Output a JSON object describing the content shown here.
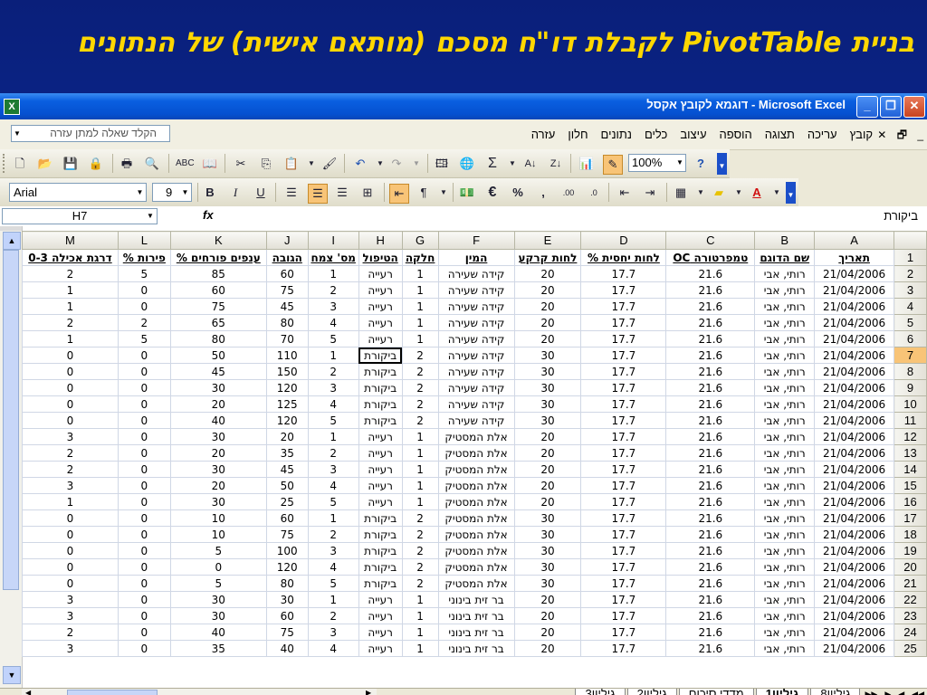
{
  "slide": {
    "title_pre": "בניית",
    "title_pivot": "PivotTable",
    "title_post": "לקבלת דו\"ח מסכם (מותאם אישית) של הנתונים"
  },
  "window": {
    "title": "Microsoft Excel - דוגמא לקובץ אקסל",
    "min": "_",
    "restore": "❐",
    "close": "✕"
  },
  "menubar": {
    "items": [
      "קובץ",
      "עריכה",
      "תצוגה",
      "הוספה",
      "עיצוב",
      "כלים",
      "נתונים",
      "חלון",
      "עזרה"
    ],
    "help_placeholder": "הקלד שאלה למתן עזרה",
    "doc_icons": [
      "✕",
      "🗗",
      "_"
    ]
  },
  "toolbar": {
    "zoom": "100%",
    "font": "Arial",
    "size": "9"
  },
  "formula": {
    "name_box": "H7",
    "fx": "fx",
    "content": "ביקורת"
  },
  "grid": {
    "columns": [
      "M",
      "L",
      "K",
      "J",
      "I",
      "H",
      "G",
      "F",
      "E",
      "D",
      "C",
      "B",
      "A"
    ],
    "selected_col": "H",
    "selected_row": "7",
    "headers": [
      "דרגת אכילה 0-3",
      "פירות %",
      "ענפים פורחים %",
      "הגובה",
      "מס' צמח",
      "הטיפול",
      "חלקה",
      "המין",
      "לחות קרקע",
      "לחות יחסית %",
      "טמפרטורה OC",
      "שם הדוגם",
      "תאריך"
    ],
    "rows": [
      [
        "2",
        "5",
        "85",
        "60",
        "1",
        "רעייה",
        "1",
        "קידה שעירה",
        "20",
        "17.7",
        "21.6",
        "רותי, אבי",
        "21/04/2006"
      ],
      [
        "1",
        "0",
        "60",
        "75",
        "2",
        "רעייה",
        "1",
        "קידה שעירה",
        "20",
        "17.7",
        "21.6",
        "רותי, אבי",
        "21/04/2006"
      ],
      [
        "1",
        "0",
        "75",
        "45",
        "3",
        "רעייה",
        "1",
        "קידה שעירה",
        "20",
        "17.7",
        "21.6",
        "רותי, אבי",
        "21/04/2006"
      ],
      [
        "2",
        "2",
        "65",
        "80",
        "4",
        "רעייה",
        "1",
        "קידה שעירה",
        "20",
        "17.7",
        "21.6",
        "רותי, אבי",
        "21/04/2006"
      ],
      [
        "1",
        "5",
        "80",
        "70",
        "5",
        "רעייה",
        "1",
        "קידה שעירה",
        "20",
        "17.7",
        "21.6",
        "רותי, אבי",
        "21/04/2006"
      ],
      [
        "0",
        "0",
        "50",
        "110",
        "1",
        "ביקורת",
        "2",
        "קידה שעירה",
        "30",
        "17.7",
        "21.6",
        "רותי, אבי",
        "21/04/2006"
      ],
      [
        "0",
        "0",
        "45",
        "150",
        "2",
        "ביקורת",
        "2",
        "קידה שעירה",
        "30",
        "17.7",
        "21.6",
        "רותי, אבי",
        "21/04/2006"
      ],
      [
        "0",
        "0",
        "30",
        "120",
        "3",
        "ביקורת",
        "2",
        "קידה שעירה",
        "30",
        "17.7",
        "21.6",
        "רותי, אבי",
        "21/04/2006"
      ],
      [
        "0",
        "0",
        "20",
        "125",
        "4",
        "ביקורת",
        "2",
        "קידה שעירה",
        "30",
        "17.7",
        "21.6",
        "רותי, אבי",
        "21/04/2006"
      ],
      [
        "0",
        "0",
        "40",
        "120",
        "5",
        "ביקורת",
        "2",
        "קידה שעירה",
        "30",
        "17.7",
        "21.6",
        "רותי, אבי",
        "21/04/2006"
      ],
      [
        "3",
        "0",
        "30",
        "20",
        "1",
        "רעייה",
        "1",
        "אלת המסטיק",
        "20",
        "17.7",
        "21.6",
        "רותי, אבי",
        "21/04/2006"
      ],
      [
        "2",
        "0",
        "20",
        "35",
        "2",
        "רעייה",
        "1",
        "אלת המסטיק",
        "20",
        "17.7",
        "21.6",
        "רותי, אבי",
        "21/04/2006"
      ],
      [
        "2",
        "0",
        "30",
        "45",
        "3",
        "רעייה",
        "1",
        "אלת המסטיק",
        "20",
        "17.7",
        "21.6",
        "רותי, אבי",
        "21/04/2006"
      ],
      [
        "3",
        "0",
        "20",
        "50",
        "4",
        "רעייה",
        "1",
        "אלת המסטיק",
        "20",
        "17.7",
        "21.6",
        "רותי, אבי",
        "21/04/2006"
      ],
      [
        "1",
        "0",
        "30",
        "25",
        "5",
        "רעייה",
        "1",
        "אלת המסטיק",
        "20",
        "17.7",
        "21.6",
        "רותי, אבי",
        "21/04/2006"
      ],
      [
        "0",
        "0",
        "10",
        "60",
        "1",
        "ביקורת",
        "2",
        "אלת המסטיק",
        "30",
        "17.7",
        "21.6",
        "רותי, אבי",
        "21/04/2006"
      ],
      [
        "0",
        "0",
        "10",
        "75",
        "2",
        "ביקורת",
        "2",
        "אלת המסטיק",
        "30",
        "17.7",
        "21.6",
        "רותי, אבי",
        "21/04/2006"
      ],
      [
        "0",
        "0",
        "5",
        "100",
        "3",
        "ביקורת",
        "2",
        "אלת המסטיק",
        "30",
        "17.7",
        "21.6",
        "רותי, אבי",
        "21/04/2006"
      ],
      [
        "0",
        "0",
        "0",
        "120",
        "4",
        "ביקורת",
        "2",
        "אלת המסטיק",
        "30",
        "17.7",
        "21.6",
        "רותי, אבי",
        "21/04/2006"
      ],
      [
        "0",
        "0",
        "5",
        "80",
        "5",
        "ביקורת",
        "2",
        "אלת המסטיק",
        "30",
        "17.7",
        "21.6",
        "רותי, אבי",
        "21/04/2006"
      ],
      [
        "3",
        "0",
        "30",
        "30",
        "1",
        "רעייה",
        "1",
        "בר זית בינוני",
        "20",
        "17.7",
        "21.6",
        "רותי, אבי",
        "21/04/2006"
      ],
      [
        "3",
        "0",
        "30",
        "60",
        "2",
        "רעייה",
        "1",
        "בר זית בינוני",
        "20",
        "17.7",
        "21.6",
        "רותי, אבי",
        "21/04/2006"
      ],
      [
        "2",
        "0",
        "40",
        "75",
        "3",
        "רעייה",
        "1",
        "בר זית בינוני",
        "20",
        "17.7",
        "21.6",
        "רותי, אבי",
        "21/04/2006"
      ],
      [
        "3",
        "0",
        "35",
        "40",
        "4",
        "רעייה",
        "1",
        "בר זית בינוני",
        "20",
        "17.7",
        "21.6",
        "רותי, אבי",
        "21/04/2006"
      ]
    ]
  },
  "sheet_tabs": [
    "גיליון8",
    "גיליון1",
    "מדדי סיכום",
    "גיליון2",
    "גיליון3"
  ],
  "active_tab": "גיליון1"
}
